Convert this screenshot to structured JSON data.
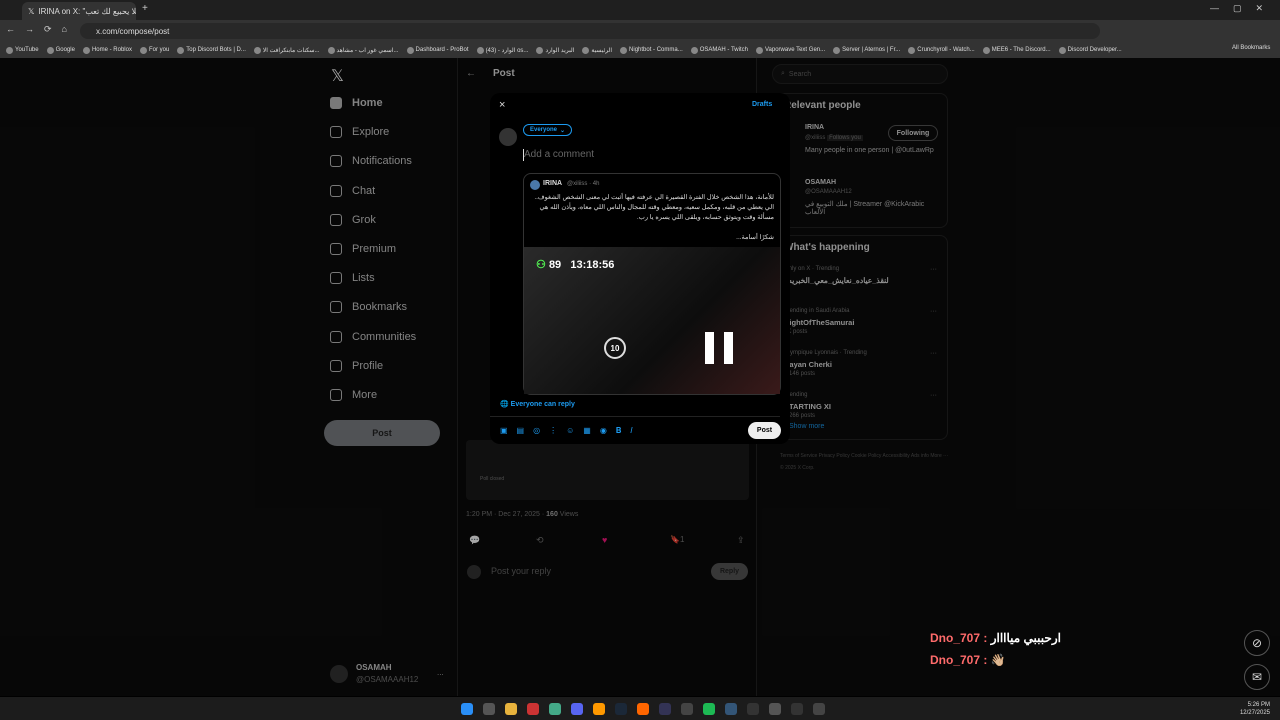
{
  "browser": {
    "tab_title": "IRINA on X: \"هللا يحبيع لك تعب\"",
    "url": "x.com/compose/post",
    "bookmarks": [
      "YouTube",
      "Google",
      "Home - Roblox",
      "For you",
      "Top Discord Bots | D...",
      "سكنات مابنكرافت الا...",
      "اسمي غور اب - مشاهد...",
      "Dashboard - ProBot",
      "(43) - الوارد os...",
      "البريد الوارد",
      "الرئيسية",
      "Nightbot - Comma...",
      "OSAMAH - Twitch",
      "Vaporwave Text Gen...",
      "Server | Aternos | Fr...",
      "Crunchyroll - Watch...",
      "MEE6 - The Discord...",
      "Discord Developer..."
    ],
    "all_bookmarks": "All Bookmarks"
  },
  "nav": {
    "items": [
      "Home",
      "Explore",
      "Notifications",
      "Chat",
      "Grok",
      "Premium",
      "Lists",
      "Bookmarks",
      "Communities",
      "Profile",
      "More"
    ],
    "post_button": "Post",
    "account_name": "OSAMAH",
    "account_handle": "@OSAMAAAH12",
    "more_dots": "..."
  },
  "center": {
    "header": "Post",
    "timestamp": "1:20 PM · Dec 27, 2025 · ",
    "views_count": "160",
    "views_label": " Views",
    "bookmark_count": "1",
    "reply_placeholder": "Post your reply",
    "reply_button": "Reply",
    "poll_closed": "Poll closed"
  },
  "right": {
    "search_placeholder": "Search",
    "relevant_title": "Relevant people",
    "people": [
      {
        "name": "IRINA",
        "handle": "@xiliiss",
        "badge": "Follows you",
        "bio": "Many people in one person | @0utLawRp",
        "button": "Following"
      },
      {
        "name": "OSAMAH",
        "handle": "@OSAMAAAH12",
        "bio": "ملك التوبيع في | Streamer @KickArabic الألعاب"
      }
    ],
    "happening_title": "What's happening",
    "trends": [
      {
        "meta": "Only on X · Trending",
        "title": "#لنقذ_عياده_نعايش_معي_الخبريه",
        "posts": ""
      },
      {
        "meta": "Trending in Saudi Arabia",
        "title": "NightOfTheSamurai",
        "posts": "5K posts"
      },
      {
        "meta": "Olympique Lyonnais · Trending",
        "title": "Rayan Cherki",
        "posts": "1,146 posts"
      },
      {
        "meta": "Trending",
        "title": "STARTING XI",
        "posts": "1,266 posts"
      }
    ],
    "show_more": "Show more",
    "footer": "Terms of Service   Privacy Policy   Cookie Policy   Accessibility   Ads info   More ···   © 2025 X Corp."
  },
  "modal": {
    "close": "×",
    "drafts": "Drafts",
    "audience": "Everyone",
    "comment_placeholder": "Add a comment",
    "quoted": {
      "name": "IRINA",
      "handle": "@xiliiss · 4h",
      "text": "للأمانة، هذا الشخص خلال الفترة القصيرة الي عرفته فيها أثبت لي معنى الشخص الشغوف.. الي يعطي من قلبه، ومكمل سعيه، ومعطي وقته للمجال والناس اللي معاه، ويأذن الله هي مسألة وقت ويتوثق حسابه، ويلقى اللي يسره يا رب.",
      "sign": "شكرًا أسامة...",
      "video_count": "89",
      "video_time": "13:18:56",
      "skip": "10"
    },
    "reply_scope": "Everyone can reply",
    "post_button": "Post"
  },
  "stream_chat": [
    {
      "user": "Dno_707",
      "text": "ارحبببي مياااار"
    },
    {
      "user": "Dno_707",
      "text": "👋🏼"
    }
  ],
  "taskbar": {
    "time": "5:26 PM",
    "date": "12/27/2025"
  }
}
